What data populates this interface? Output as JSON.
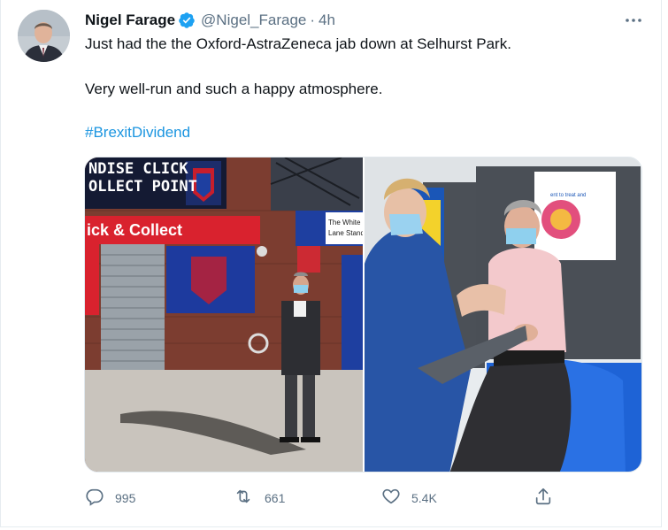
{
  "tweet": {
    "author": {
      "display_name": "Nigel Farage",
      "handle": "@Nigel_Farage",
      "verified": true,
      "avatar_icon": "profile-photo"
    },
    "separator": "·",
    "timestamp": "4h",
    "more_icon": "more-dots-icon",
    "text_lines": [
      "Just had the the Oxford-AstraZeneca jab down at Selhurst Park.",
      "Very well-run and such a happy atmosphere."
    ],
    "hashtag": "#BrexitDividend",
    "media": {
      "photo_left": {
        "signs": {
          "top": [
            "NDISE CLICK",
            "OLLECT POINT"
          ],
          "red_banner": "ick & Collect",
          "blue_sign": [
            "The White",
            "Lane Stand"
          ]
        }
      },
      "photo_right": {
        "poster_text": "ent to treat and"
      }
    },
    "actions": {
      "reply": {
        "icon": "reply-icon",
        "count": "995"
      },
      "retweet": {
        "icon": "retweet-icon",
        "count": "661"
      },
      "like": {
        "icon": "like-icon",
        "count": "5.4K"
      },
      "share": {
        "icon": "share-icon"
      }
    },
    "colors": {
      "verified_blue": "#1da1f2",
      "link_blue": "#1b95e0",
      "secondary_text": "#5b7083"
    }
  }
}
